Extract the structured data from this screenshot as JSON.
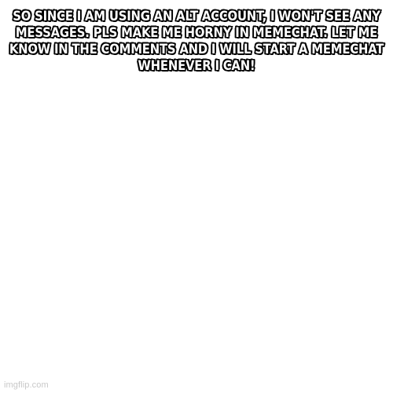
{
  "meme": {
    "top_text": "SO SINCE I AM USING AN ALT ACCOUNT, I WON'T SEE ANY MESSAGES. PLS MAKE ME HORNY IN MEMECHAT. LET ME KNOW IN THE COMMENTS AND I WILL START A MEMECHAT WHENEVER I CAN!",
    "watermark": "imgflip.com",
    "background_color": "#ffffff",
    "text_color": "#ffffff",
    "text_outline_color": "#000000"
  }
}
